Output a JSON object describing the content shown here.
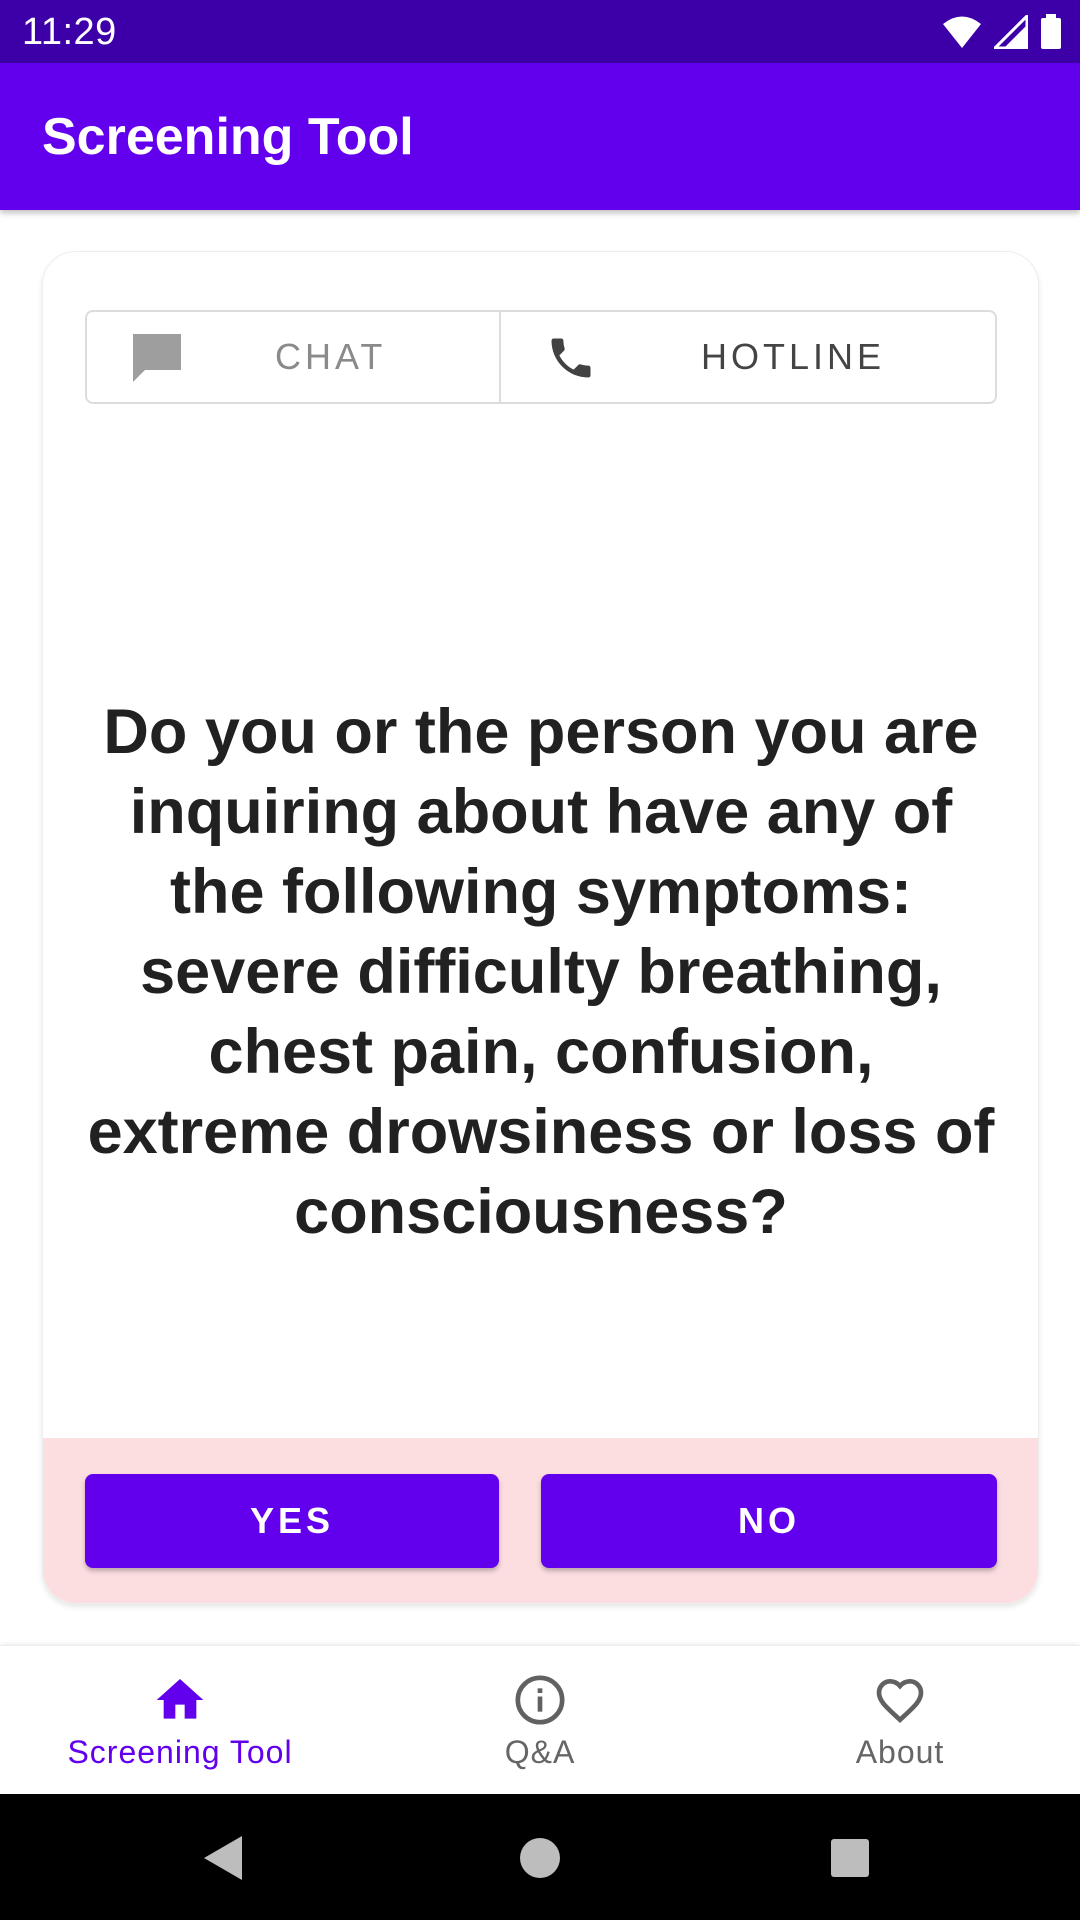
{
  "status_bar": {
    "time": "11:29",
    "icons": [
      "wifi-icon",
      "signal-icon",
      "battery-icon"
    ]
  },
  "app_bar": {
    "title": "Screening Tool"
  },
  "contact_toggle": {
    "chat_label": "CHAT",
    "hotline_label": "HOTLINE",
    "chat_icon": "chat-icon",
    "hotline_icon": "phone-icon"
  },
  "question": {
    "text": "Do you or the person you are inquiring about have any of the following symptoms: severe difficulty breathing, chest pain, confusion, extreme drowsiness or loss of consciousness?"
  },
  "answers": {
    "yes_label": "YES",
    "no_label": "NO"
  },
  "bottom_nav": {
    "items": [
      {
        "label": "Screening Tool",
        "icon": "home-icon",
        "active": true
      },
      {
        "label": "Q&A",
        "icon": "info-icon",
        "active": false
      },
      {
        "label": "About",
        "icon": "heart-icon",
        "active": false
      }
    ]
  },
  "system_nav": {
    "icons": [
      "back-icon",
      "home-circle-icon",
      "recents-icon"
    ]
  },
  "colors": {
    "primary": "#6200ee",
    "status_bar": "#3d00a8",
    "answer_area": "#fcdde0",
    "text_dark": "#212121"
  }
}
